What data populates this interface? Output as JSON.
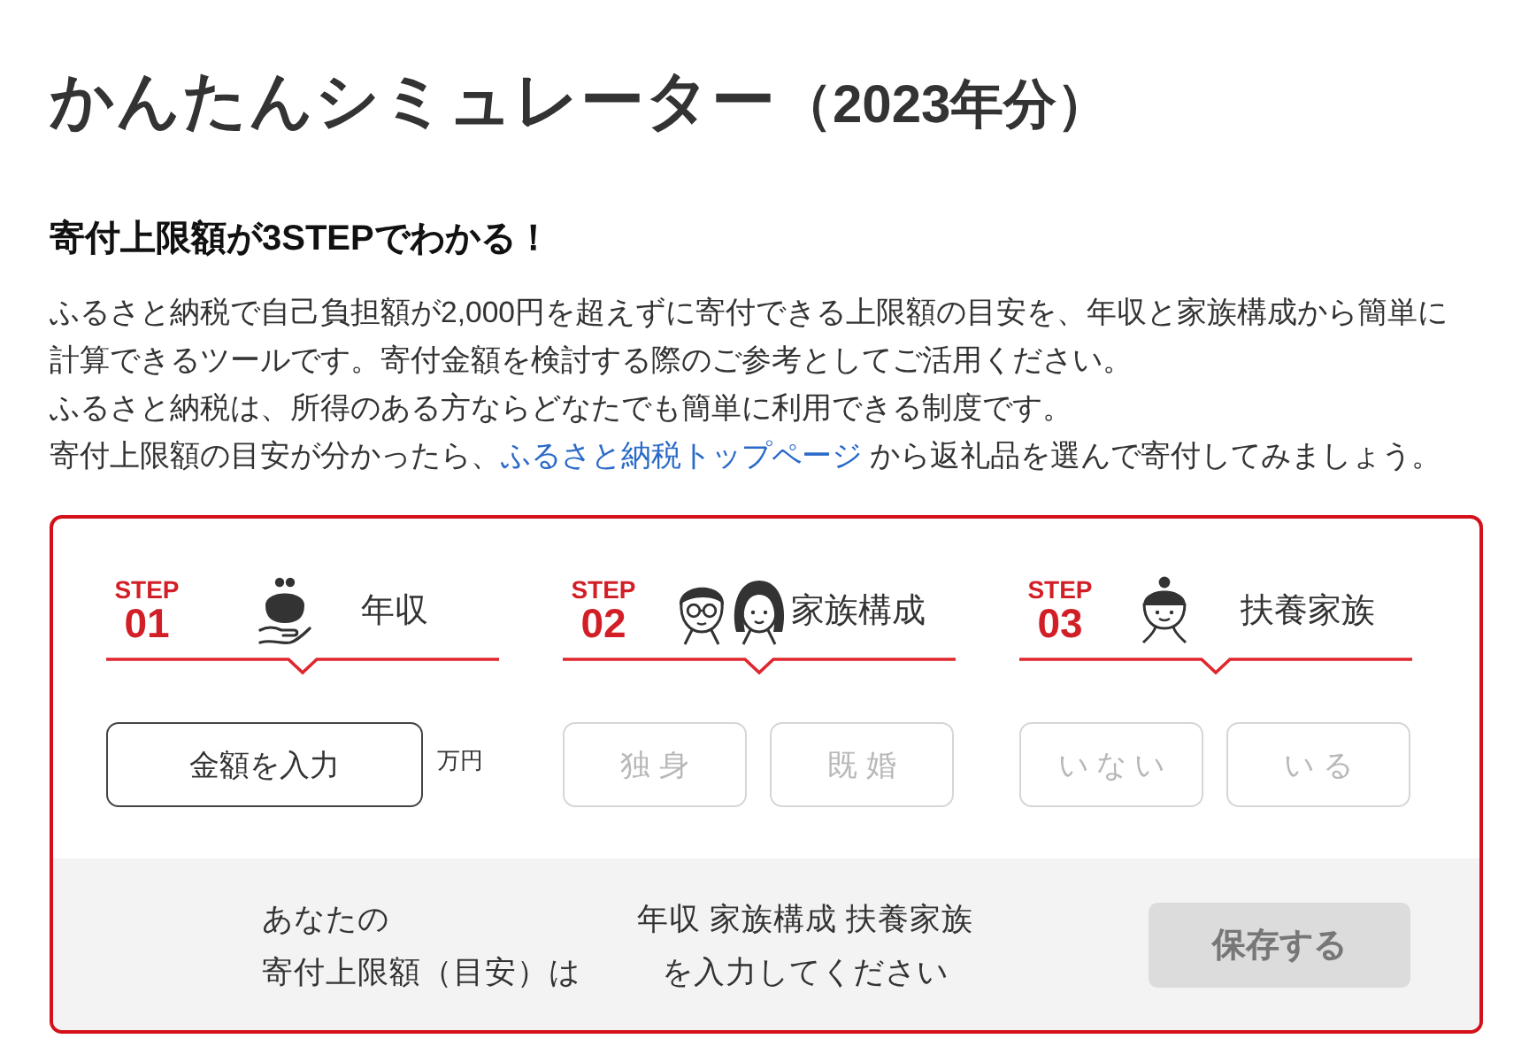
{
  "page": {
    "title": "かんたんシミュレーター",
    "year": "（2023年分）"
  },
  "subheading": "寄付上限額が3STEPでわかる！",
  "intro": {
    "paragraphs": [
      "ふるさと納税で自己負担額が2,000円を超えずに寄付できる上限額の目安を、年収と家族構成から簡単に計算できるツールです。寄付金額を検討する際のご参考としてご活用ください。",
      "ふるさと納税は、所得のある方ならどなたでも簡単に利用できる制度です。"
    ],
    "closing": {
      "before": "寄付上限額の目安が分かったら、",
      "link": "ふるさと納税トップページ",
      "after": " から返礼品を選んで寄付してみましょう。"
    }
  },
  "steps": [
    {
      "step_label": "STEP",
      "number": "01",
      "title": "年収",
      "kind": "amount",
      "button": "金額を入力",
      "unit": "万円"
    },
    {
      "step_label": "STEP",
      "number": "02",
      "title": "家族構成",
      "kind": "choice",
      "options": [
        {
          "label": "独 身",
          "selected": false,
          "disabled": true
        },
        {
          "label": "既 婚",
          "selected": false,
          "disabled": true
        }
      ]
    },
    {
      "step_label": "STEP",
      "number": "03",
      "title": "扶養家族",
      "kind": "choice",
      "options": [
        {
          "label": "い な い",
          "selected": false,
          "disabled": true
        },
        {
          "label": "い る",
          "selected": false,
          "disabled": true
        }
      ]
    }
  ],
  "result": {
    "label_lines": [
      "あなたの",
      "寄付上限額（目安）は"
    ],
    "message_lines": [
      "年収 家族構成 扶養家族",
      "を入力してください"
    ],
    "save_button": {
      "label": "保存する",
      "disabled": true
    }
  }
}
